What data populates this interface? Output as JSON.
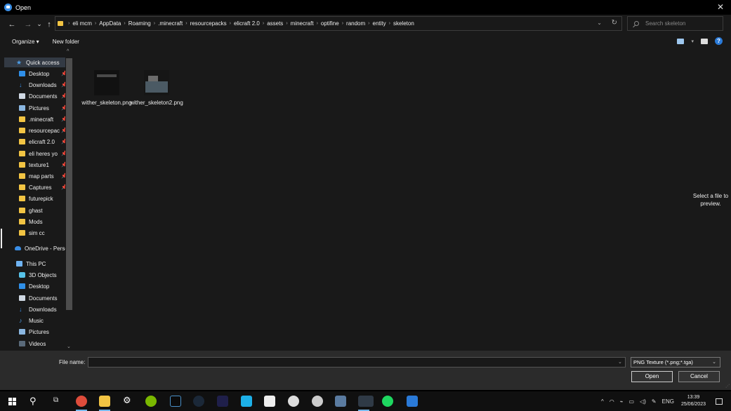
{
  "title": "Open",
  "nav_buttons": [
    "←",
    "→",
    "⌄",
    "↑"
  ],
  "breadcrumb": [
    "eli mcm",
    "AppData",
    "Roaming",
    ".minecraft",
    "resourcepacks",
    "elicraft 2.0",
    "assets",
    "minecraft",
    "optifine",
    "random",
    "entity",
    "skeleton"
  ],
  "search": {
    "placeholder": "Search skeleton"
  },
  "toolbar": {
    "organize": "Organize ▾",
    "new_folder": "New folder"
  },
  "sidebar": {
    "items": [
      {
        "label": "Quick access",
        "icon": "star-icon",
        "pinned": false
      },
      {
        "label": "Desktop",
        "icon": "desktop-icon",
        "pinned": true
      },
      {
        "label": "Downloads",
        "icon": "download-icon",
        "pinned": true
      },
      {
        "label": "Documents",
        "icon": "document-icon",
        "pinned": true
      },
      {
        "label": "Pictures",
        "icon": "pictures-icon",
        "pinned": true
      },
      {
        "label": ".minecraft",
        "icon": "folder-icon",
        "pinned": true
      },
      {
        "label": "resourcepac",
        "icon": "folder-icon",
        "pinned": true
      },
      {
        "label": "elicraft 2.0",
        "icon": "folder-icon",
        "pinned": true
      },
      {
        "label": "eli heres yo",
        "icon": "folder-icon",
        "pinned": true
      },
      {
        "label": "texture1",
        "icon": "folder-icon",
        "pinned": true
      },
      {
        "label": "map parts",
        "icon": "folder-icon",
        "pinned": true
      },
      {
        "label": "Captures",
        "icon": "folder-icon",
        "pinned": true
      },
      {
        "label": "futurepick",
        "icon": "folder-icon",
        "pinned": false
      },
      {
        "label": "ghast",
        "icon": "folder-icon",
        "pinned": false
      },
      {
        "label": "Mods",
        "icon": "folder-icon",
        "pinned": false
      },
      {
        "label": "sim cc",
        "icon": "folder-icon",
        "pinned": false
      },
      {
        "label": "OneDrive - Perso",
        "icon": "onedrive-icon",
        "pinned": false
      },
      {
        "label": "This PC",
        "icon": "pc-icon",
        "pinned": false
      },
      {
        "label": "3D Objects",
        "icon": "3d-objects-icon",
        "pinned": false
      },
      {
        "label": "Desktop",
        "icon": "desktop-icon",
        "pinned": false
      },
      {
        "label": "Documents",
        "icon": "document-icon",
        "pinned": false
      },
      {
        "label": "Downloads",
        "icon": "download-icon",
        "pinned": false
      },
      {
        "label": "Music",
        "icon": "music-icon",
        "pinned": false
      },
      {
        "label": "Pictures",
        "icon": "pictures-icon",
        "pinned": false
      },
      {
        "label": "Videos",
        "icon": "videos-icon",
        "pinned": false
      }
    ]
  },
  "files": [
    {
      "name": "wither_skeleton.png"
    },
    {
      "name": "wither_skeleton2.png"
    }
  ],
  "preview_text": "Select a file to preview.",
  "footer": {
    "file_name_label": "File name:",
    "file_name_value": "",
    "file_type": "PNG Texture (*.png;*.tga)",
    "open_label": "Open",
    "cancel_label": "Cancel"
  },
  "taskbar": {
    "apps": [
      "chrome-icon",
      "file-explorer-icon",
      "settings-icon",
      "xbox-icon",
      "vegas-icon",
      "steam-icon",
      "after-effects-icon",
      "app-icon",
      "minecraft-icon",
      "osu-icon",
      "app-icon",
      "paint-icon",
      "app-icon",
      "spotify-icon",
      "notepad-icon"
    ],
    "lang": "ENG",
    "time": "13:39",
    "date": "25/06/2023"
  }
}
